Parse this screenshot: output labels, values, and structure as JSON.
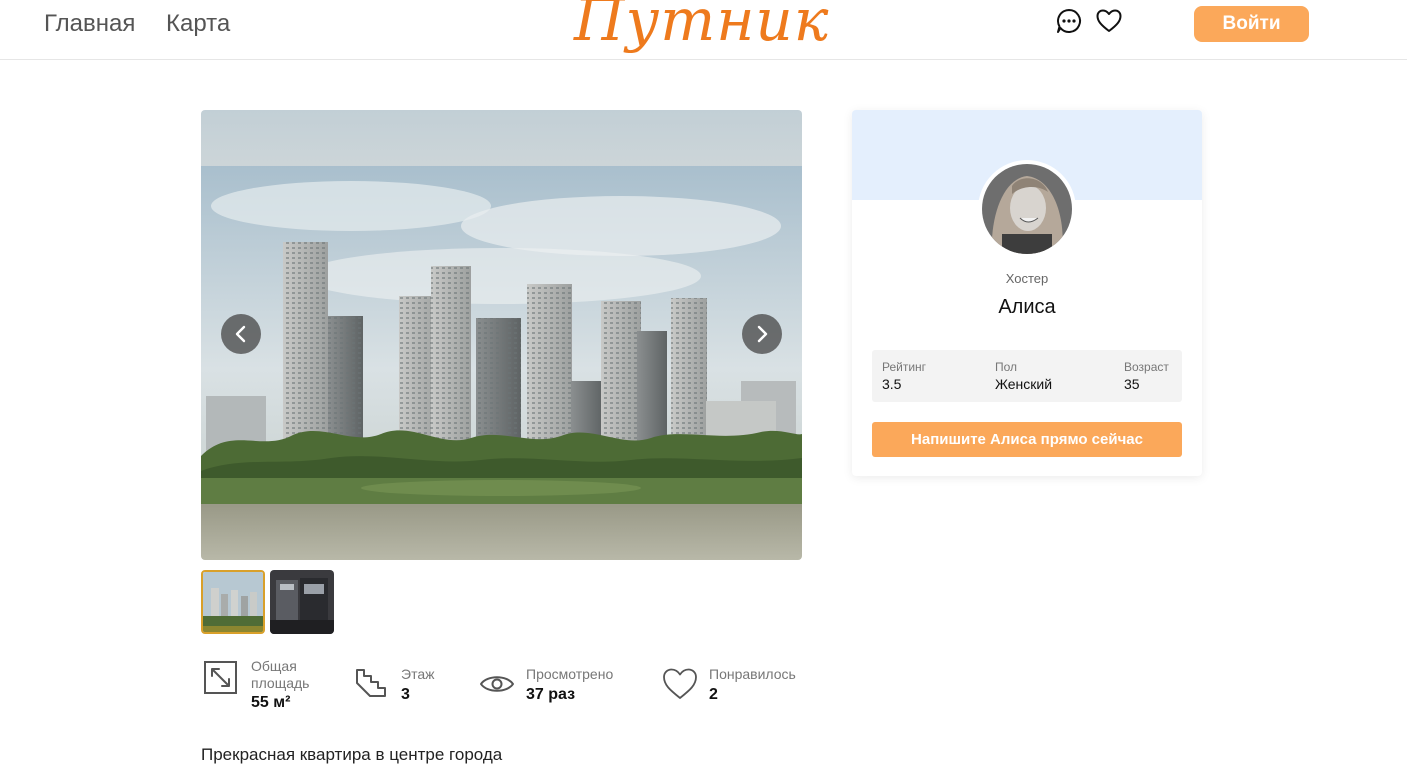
{
  "header": {
    "nav": [
      {
        "label": "Главная",
        "icon": null
      },
      {
        "label": "Карта",
        "icon": null
      }
    ],
    "logo_text": "Путник",
    "icons": [
      "chat-icon",
      "heart-icon"
    ],
    "login_label": "Войти"
  },
  "colors": {
    "accent": "#fba85a",
    "logo": "#ee7a1d",
    "banner": "#e4effd",
    "thumb_active_border": "#d9a02a"
  },
  "gallery": {
    "icons": [
      "chevron-left-icon",
      "chevron-right-icon"
    ],
    "active_thumb": 1,
    "thumb_count": 2
  },
  "stats": [
    {
      "icon": "area-icon",
      "label": "Общая площадь",
      "value": "55 м²"
    },
    {
      "icon": "stairs-icon",
      "label": "Этаж",
      "value": "3"
    },
    {
      "icon": "eye-icon",
      "label": "Просмотрено",
      "value": "37 раз"
    },
    {
      "icon": "heart-outline-icon",
      "label": "Понравилось",
      "value": "2"
    }
  ],
  "description": "Прекрасная квартира в центре города",
  "host": {
    "role": "Хостер",
    "name": "Алиса",
    "info": [
      {
        "label": "Рейтинг",
        "value": "3.5"
      },
      {
        "label": "Пол",
        "value": "Женский"
      },
      {
        "label": "Возраст",
        "value": "35"
      }
    ],
    "message_label": "Напишите Алиса прямо сейчас"
  }
}
